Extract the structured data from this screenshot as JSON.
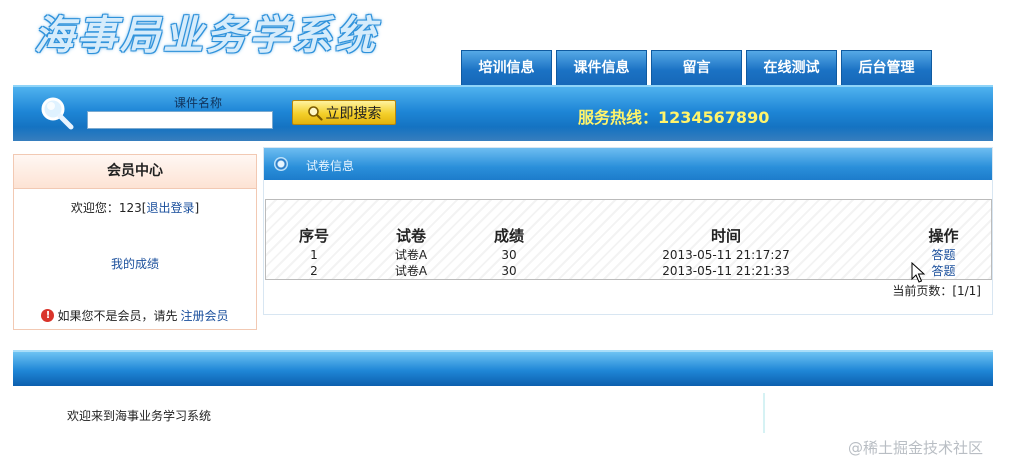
{
  "header": {
    "logo_text": "海事局业务学系统"
  },
  "nav": {
    "tabs": [
      {
        "label": "培训信息"
      },
      {
        "label": "课件信息"
      },
      {
        "label": "留言"
      },
      {
        "label": "在线测试"
      },
      {
        "label": "后台管理"
      }
    ]
  },
  "search": {
    "label": "课件名称",
    "value": "",
    "button_label": "立即搜索",
    "hotline": "服务热线：1234567890"
  },
  "member": {
    "title": "会员中心",
    "welcome_prefix": "欢迎您：",
    "username": "123",
    "logout_label": "退出登录",
    "my_scores_label": "我的成绩",
    "notice_text": "如果您不是会员，请先",
    "register_label": "注册会员"
  },
  "papers": {
    "section_title": "试卷信息",
    "columns": [
      "序号",
      "试卷",
      "成绩",
      "时间",
      "操作"
    ],
    "rows": [
      {
        "index": "1",
        "paper": "试卷A",
        "score": "30",
        "time": "2013-05-11 21:17:27",
        "action": "答题"
      },
      {
        "index": "2",
        "paper": "试卷A",
        "score": "30",
        "time": "2013-05-11 21:21:33",
        "action": "答题"
      }
    ],
    "pager": "当前页数：[1/1]"
  },
  "footer": {
    "text": "欢迎来到海事业务学习系统"
  },
  "watermark": "@稀土掘金技术社区",
  "colors": {
    "nav_blue": "#1b72c4",
    "bar_blue": "#1e86d6",
    "hotline_yellow": "#fff46b",
    "link_blue": "#1a4f9c"
  }
}
